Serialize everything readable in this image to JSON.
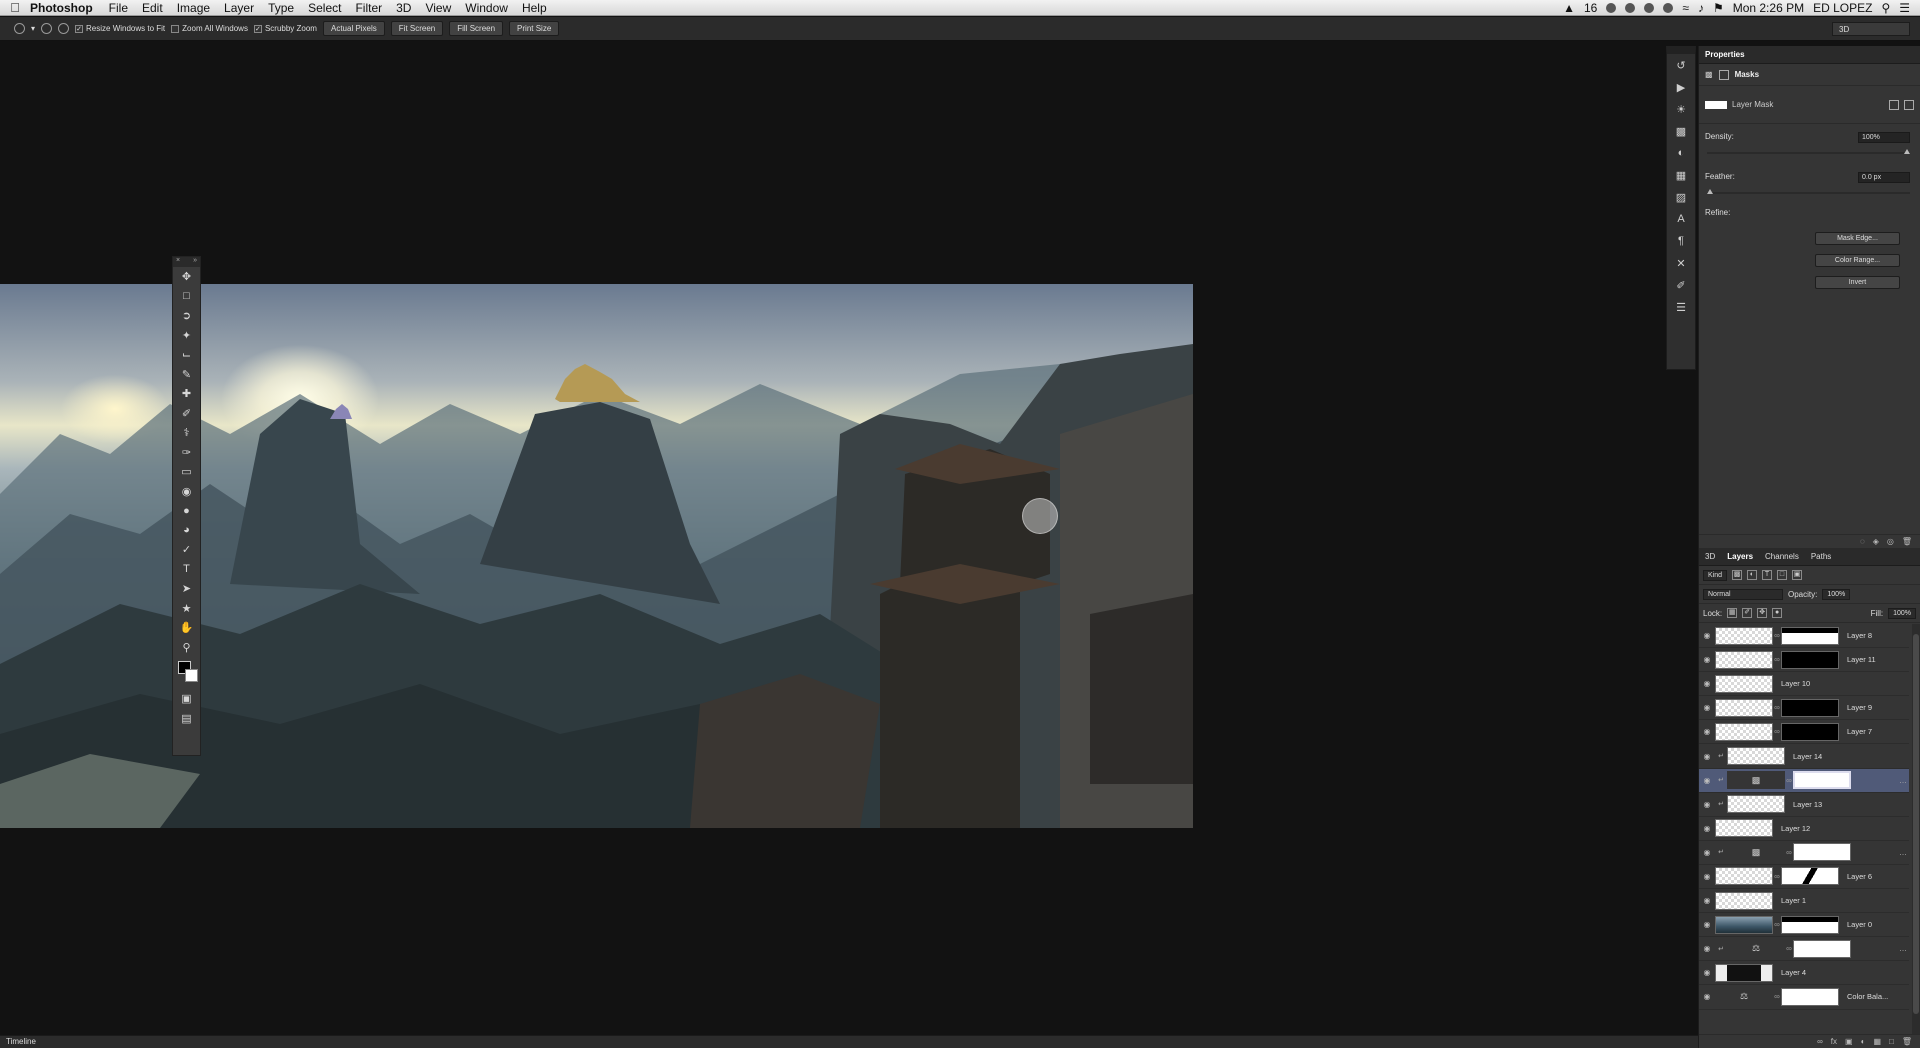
{
  "menubar": {
    "app_name": "Photoshop",
    "items": [
      "File",
      "Edit",
      "Image",
      "Layer",
      "Type",
      "Select",
      "Filter",
      "3D",
      "View",
      "Window",
      "Help"
    ],
    "right_clock": "Mon 2:26 PM",
    "right_user": "ED LOPEZ",
    "right_badge": "16"
  },
  "options": {
    "resize_windows": "Resize Windows to Fit",
    "zoom_all": "Zoom All Windows",
    "scrubby_zoom": "Scrubby Zoom",
    "actual_pixels": "Actual Pixels",
    "fit_screen": "Fit Screen",
    "fill_screen": "Fill Screen",
    "print_size": "Print Size",
    "workspace": "3D"
  },
  "properties": {
    "panel_title": "Properties",
    "masks_label": "Masks",
    "layer_mask_label": "Layer Mask",
    "density_label": "Density:",
    "density_value": "100%",
    "feather_label": "Feather:",
    "feather_value": "0.0 px",
    "refine_label": "Refine:",
    "mask_edge_button": "Mask Edge...",
    "color_range_button": "Color Range...",
    "invert_button": "Invert"
  },
  "layers_panel": {
    "tabs": [
      "3D",
      "Layers",
      "Channels",
      "Paths"
    ],
    "kind_filter": "Kind",
    "blend_mode": "Normal",
    "opacity_label": "Opacity:",
    "opacity_value": "100%",
    "lock_label": "Lock:",
    "fill_label": "Fill:",
    "fill_value": "100%",
    "layers": [
      {
        "name": "Layer 8"
      },
      {
        "name": "Layer 11"
      },
      {
        "name": "Layer 10"
      },
      {
        "name": "Layer 9"
      },
      {
        "name": "Layer 7"
      },
      {
        "name": "Layer 14"
      },
      {
        "name": ""
      },
      {
        "name": "Layer 13"
      },
      {
        "name": "Layer 12"
      },
      {
        "name": ""
      },
      {
        "name": "Layer 6"
      },
      {
        "name": "Layer 1"
      },
      {
        "name": "Layer 0"
      },
      {
        "name": ""
      },
      {
        "name": "Layer 4"
      },
      {
        "name": "Color Bala..."
      }
    ]
  },
  "timeline": {
    "label": "Timeline"
  }
}
